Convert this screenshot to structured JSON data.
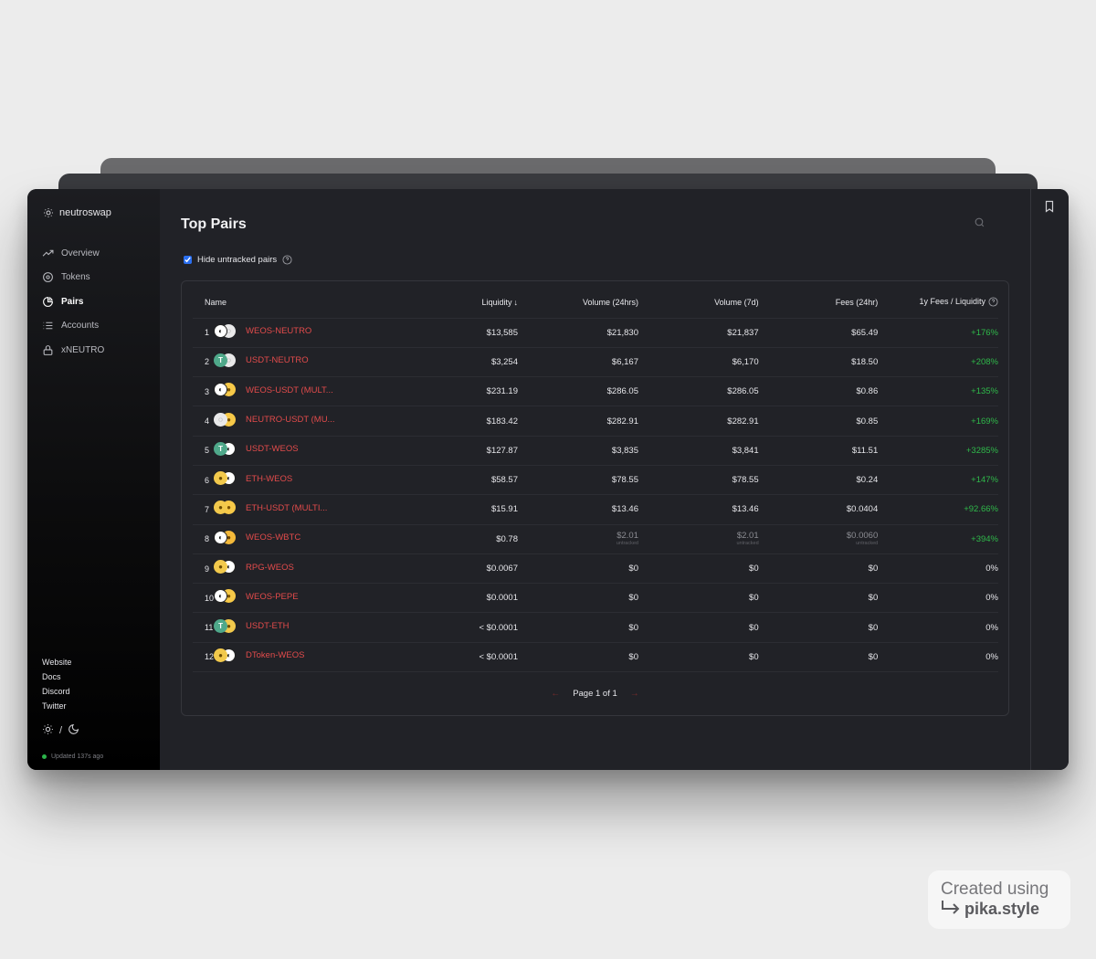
{
  "app": {
    "name": "neutroswap"
  },
  "sidebar": {
    "nav": [
      {
        "label": "Overview",
        "icon": "trending-up-icon",
        "active": false
      },
      {
        "label": "Tokens",
        "icon": "coin-icon",
        "active": false
      },
      {
        "label": "Pairs",
        "icon": "pie-chart-icon",
        "active": true
      },
      {
        "label": "Accounts",
        "icon": "list-icon",
        "active": false
      },
      {
        "label": "xNEUTRO",
        "icon": "lock-icon",
        "active": false
      }
    ],
    "links": [
      "Website",
      "Docs",
      "Discord",
      "Twitter"
    ],
    "theme_separator": "/",
    "updated": "Updated 137s ago"
  },
  "page": {
    "title": "Top Pairs",
    "filter_label": "Hide untracked pairs",
    "filter_checked": true
  },
  "table": {
    "headers": {
      "name": "Name",
      "liquidity": "Liquidity",
      "liquidity_sort": "↓",
      "volume24": "Volume (24hrs)",
      "volume7d": "Volume (7d)",
      "fees24": "Fees (24hr)",
      "apr": "1y Fees / Liquidity"
    },
    "rows": [
      {
        "rank": "1",
        "name": "WEOS-NEUTRO",
        "t0": "weos",
        "t1": "neutro",
        "liquidity": "$13,585",
        "vol24": "$21,830",
        "vol7": "$21,837",
        "fees": "$65.49",
        "apr": "+176%"
      },
      {
        "rank": "2",
        "name": "USDT-NEUTRO",
        "t0": "usdt",
        "t1": "neutro",
        "liquidity": "$3,254",
        "vol24": "$6,167",
        "vol7": "$6,170",
        "fees": "$18.50",
        "apr": "+208%"
      },
      {
        "rank": "3",
        "name": "WEOS-USDT (MULT...",
        "t0": "weos",
        "t1": "gold",
        "liquidity": "$231.19",
        "vol24": "$286.05",
        "vol7": "$286.05",
        "fees": "$0.86",
        "apr": "+135%"
      },
      {
        "rank": "4",
        "name": "NEUTRO-USDT (MU...",
        "t0": "neutro",
        "t1": "gold",
        "liquidity": "$183.42",
        "vol24": "$282.91",
        "vol7": "$282.91",
        "fees": "$0.85",
        "apr": "+169%"
      },
      {
        "rank": "5",
        "name": "USDT-WEOS",
        "t0": "usdt",
        "t1": "weos",
        "liquidity": "$127.87",
        "vol24": "$3,835",
        "vol7": "$3,841",
        "fees": "$11.51",
        "apr": "+3285%"
      },
      {
        "rank": "6",
        "name": "ETH-WEOS",
        "t0": "eth",
        "t1": "weos",
        "liquidity": "$58.57",
        "vol24": "$78.55",
        "vol7": "$78.55",
        "fees": "$0.24",
        "apr": "+147%"
      },
      {
        "rank": "7",
        "name": "ETH-USDT (MULTI...",
        "t0": "eth",
        "t1": "gold",
        "liquidity": "$15.91",
        "vol24": "$13.46",
        "vol7": "$13.46",
        "fees": "$0.0404",
        "apr": "+92.66%"
      },
      {
        "rank": "8",
        "name": "WEOS-WBTC",
        "t0": "weos",
        "t1": "btc",
        "liquidity": "$0.78",
        "vol24": "$2.01",
        "vol7": "$2.01",
        "fees": "$0.0060",
        "apr": "+394%",
        "untracked": true,
        "untracked_label": "untracked"
      },
      {
        "rank": "9",
        "name": "RPG-WEOS",
        "t0": "eth",
        "t1": "weos",
        "liquidity": "$0.0067",
        "vol24": "$0",
        "vol7": "$0",
        "fees": "$0",
        "apr": "0%"
      },
      {
        "rank": "10",
        "name": "WEOS-PEPE",
        "t0": "weos",
        "t1": "gold",
        "liquidity": "$0.0001",
        "vol24": "$0",
        "vol7": "$0",
        "fees": "$0",
        "apr": "0%"
      },
      {
        "rank": "11",
        "name": "USDT-ETH",
        "t0": "usdt",
        "t1": "eth",
        "liquidity": "< $0.0001",
        "vol24": "$0",
        "vol7": "$0",
        "fees": "$0",
        "apr": "0%"
      },
      {
        "rank": "12",
        "name": "DToken-WEOS",
        "t0": "eth",
        "t1": "weos",
        "liquidity": "< $0.0001",
        "vol24": "$0",
        "vol7": "$0",
        "fees": "$0",
        "apr": "0%"
      }
    ]
  },
  "pagination": {
    "label": "Page 1 of 1",
    "prev": "←",
    "next": "→"
  },
  "watermark": {
    "line1": "Created using",
    "line2": "pika.style"
  },
  "colors": {
    "accent_red": "#e24b4b",
    "positive_green": "#2fb84a",
    "background": "#212227"
  }
}
